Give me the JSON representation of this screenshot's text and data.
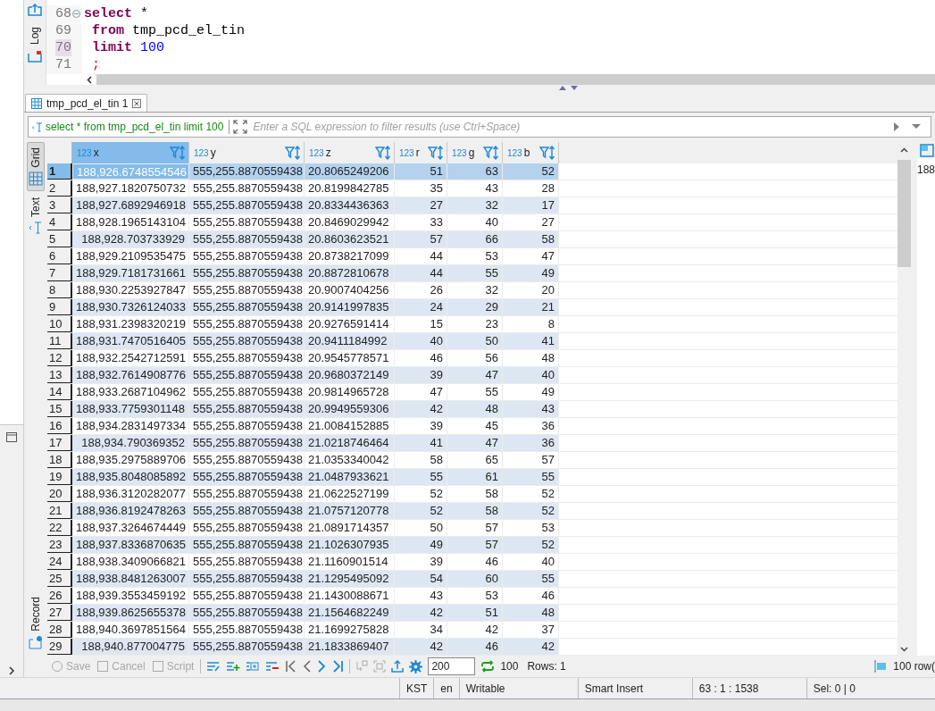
{
  "editor": {
    "lines": [
      {
        "number": "68",
        "current": false,
        "folding": true,
        "tokens": [
          {
            "kind": "keyword",
            "text": "select"
          },
          {
            "kind": "plain",
            "text": " *"
          }
        ]
      },
      {
        "number": "69",
        "current": false,
        "folding": false,
        "tokens": [
          {
            "kind": "keyword",
            "text": " from"
          },
          {
            "kind": "plain",
            "text": " tmp_pcd_el_tin"
          }
        ]
      },
      {
        "number": "70",
        "current": true,
        "folding": false,
        "tokens": [
          {
            "kind": "keyword",
            "text": " limit"
          },
          {
            "kind": "number",
            "text": " 100"
          }
        ]
      },
      {
        "number": "71",
        "current": false,
        "folding": false,
        "tokens": [
          {
            "kind": "punct",
            "text": " ;"
          }
        ]
      }
    ],
    "side_label": "Log"
  },
  "results_tab": {
    "label": "tmp_pcd_el_tin 1",
    "selected": true
  },
  "filter": {
    "query": "select * from tmp_pcd_el_tin limit 100",
    "placeholder": "Enter a SQL expression to filter results (use Ctrl+Space)"
  },
  "view_tabs": [
    {
      "label": "Grid",
      "selected": true
    },
    {
      "label": "Text",
      "selected": false
    },
    {
      "label": "Record",
      "selected": false
    }
  ],
  "grid": {
    "columns": [
      {
        "type": "123",
        "name": "x",
        "selected": true
      },
      {
        "type": "123",
        "name": "y",
        "selected": false
      },
      {
        "type": "123",
        "name": "z",
        "selected": false
      },
      {
        "type": "123",
        "name": "r",
        "selected": false
      },
      {
        "type": "123",
        "name": "g",
        "selected": false
      },
      {
        "type": "123",
        "name": "b",
        "selected": false
      }
    ],
    "rows": [
      {
        "n": "1",
        "selected": true,
        "cells": [
          "188,926.6748554546",
          "555,255.8870559438",
          "20.8065249206",
          "51",
          "63",
          "52"
        ]
      },
      {
        "n": "2",
        "selected": false,
        "cells": [
          "188,927.1820750732",
          "555,255.8870559438",
          "20.8199842785",
          "35",
          "43",
          "28"
        ]
      },
      {
        "n": "3",
        "selected": false,
        "cells": [
          "188,927.6892946918",
          "555,255.8870559438",
          "20.8334436363",
          "27",
          "32",
          "17"
        ]
      },
      {
        "n": "4",
        "selected": false,
        "cells": [
          "188,928.1965143104",
          "555,255.8870559438",
          "20.8469029942",
          "33",
          "40",
          "27"
        ]
      },
      {
        "n": "5",
        "selected": false,
        "cells": [
          "188,928.703733929",
          "555,255.8870559438",
          "20.8603623521",
          "57",
          "66",
          "58"
        ]
      },
      {
        "n": "6",
        "selected": false,
        "cells": [
          "188,929.2109535475",
          "555,255.8870559438",
          "20.8738217099",
          "44",
          "53",
          "47"
        ]
      },
      {
        "n": "7",
        "selected": false,
        "cells": [
          "188,929.7181731661",
          "555,255.8870559438",
          "20.8872810678",
          "44",
          "55",
          "49"
        ]
      },
      {
        "n": "8",
        "selected": false,
        "cells": [
          "188,930.2253927847",
          "555,255.8870559438",
          "20.9007404256",
          "26",
          "32",
          "20"
        ]
      },
      {
        "n": "9",
        "selected": false,
        "cells": [
          "188,930.7326124033",
          "555,255.8870559438",
          "20.9141997835",
          "24",
          "29",
          "21"
        ]
      },
      {
        "n": "10",
        "selected": false,
        "cells": [
          "188,931.2398320219",
          "555,255.8870559438",
          "20.9276591414",
          "15",
          "23",
          "8"
        ]
      },
      {
        "n": "11",
        "selected": false,
        "cells": [
          "188,931.7470516405",
          "555,255.8870559438",
          "20.9411184992",
          "40",
          "50",
          "41"
        ]
      },
      {
        "n": "12",
        "selected": false,
        "cells": [
          "188,932.2542712591",
          "555,255.8870559438",
          "20.9545778571",
          "46",
          "56",
          "48"
        ]
      },
      {
        "n": "13",
        "selected": false,
        "cells": [
          "188,932.7614908776",
          "555,255.8870559438",
          "20.9680372149",
          "39",
          "47",
          "40"
        ]
      },
      {
        "n": "14",
        "selected": false,
        "cells": [
          "188,933.2687104962",
          "555,255.8870559438",
          "20.9814965728",
          "47",
          "55",
          "49"
        ]
      },
      {
        "n": "15",
        "selected": false,
        "cells": [
          "188,933.7759301148",
          "555,255.8870559438",
          "20.9949559306",
          "42",
          "48",
          "43"
        ]
      },
      {
        "n": "16",
        "selected": false,
        "cells": [
          "188,934.2831497334",
          "555,255.8870559438",
          "21.0084152885",
          "39",
          "45",
          "36"
        ]
      },
      {
        "n": "17",
        "selected": false,
        "cells": [
          "188,934.790369352",
          "555,255.8870559438",
          "21.0218746464",
          "41",
          "47",
          "36"
        ]
      },
      {
        "n": "18",
        "selected": false,
        "cells": [
          "188,935.2975889706",
          "555,255.8870559438",
          "21.0353340042",
          "58",
          "65",
          "57"
        ]
      },
      {
        "n": "19",
        "selected": false,
        "cells": [
          "188,935.8048085892",
          "555,255.8870559438",
          "21.0487933621",
          "55",
          "61",
          "55"
        ]
      },
      {
        "n": "20",
        "selected": false,
        "cells": [
          "188,936.3120282077",
          "555,255.8870559438",
          "21.0622527199",
          "52",
          "58",
          "52"
        ]
      },
      {
        "n": "21",
        "selected": false,
        "cells": [
          "188,936.8192478263",
          "555,255.8870559438",
          "21.0757120778",
          "52",
          "58",
          "52"
        ]
      },
      {
        "n": "22",
        "selected": false,
        "cells": [
          "188,937.3264674449",
          "555,255.8870559438",
          "21.0891714357",
          "50",
          "57",
          "53"
        ]
      },
      {
        "n": "23",
        "selected": false,
        "cells": [
          "188,937.8336870635",
          "555,255.8870559438",
          "21.1026307935",
          "49",
          "57",
          "52"
        ]
      },
      {
        "n": "24",
        "selected": false,
        "cells": [
          "188,938.3409066821",
          "555,255.8870559438",
          "21.1160901514",
          "39",
          "46",
          "40"
        ]
      },
      {
        "n": "25",
        "selected": false,
        "cells": [
          "188,938.8481263007",
          "555,255.8870559438",
          "21.1295495092",
          "54",
          "60",
          "55"
        ]
      },
      {
        "n": "26",
        "selected": false,
        "cells": [
          "188,939.3553459192",
          "555,255.8870559438",
          "21.1430088671",
          "43",
          "53",
          "46"
        ]
      },
      {
        "n": "27",
        "selected": false,
        "cells": [
          "188,939.8625655378",
          "555,255.8870559438",
          "21.1564682249",
          "42",
          "51",
          "48"
        ]
      },
      {
        "n": "28",
        "selected": false,
        "cells": [
          "188,940.3697851564",
          "555,255.8870559438",
          "21.1699275828",
          "34",
          "42",
          "37"
        ]
      },
      {
        "n": "29",
        "selected": false,
        "cells": [
          "188,940.877004775",
          "555,255.8870559438",
          "21.1833869407",
          "42",
          "46",
          "42"
        ]
      }
    ]
  },
  "value_panel": {
    "text": "188"
  },
  "toolbar": {
    "save": {
      "label": "Save",
      "disabled": true
    },
    "cancel": {
      "label": "Cancel",
      "disabled": true
    },
    "script": {
      "label": "Script",
      "disabled": true
    },
    "fetch_size": "200",
    "fetched": "100",
    "rows_label": "Rows: 1",
    "row_count": "100 row("
  },
  "status_bar": [
    "KST",
    "en",
    "Writable",
    "Smart Insert",
    "63 : 1 : 1538",
    "Sel: 0 | 0"
  ]
}
